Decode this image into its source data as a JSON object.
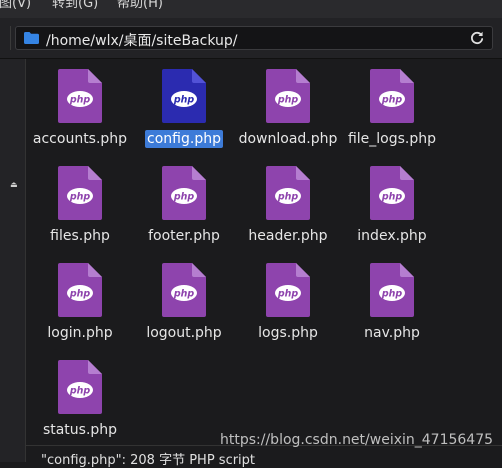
{
  "menubar": {
    "items": [
      {
        "label": "视图(V)"
      },
      {
        "label": "转到(G)"
      },
      {
        "label": "帮助(H)"
      }
    ]
  },
  "pathbar": {
    "path": "/home/wlx/桌面/siteBackup/"
  },
  "files": [
    {
      "name": "accounts.php",
      "selected": false
    },
    {
      "name": "config.php",
      "selected": true
    },
    {
      "name": "download.php",
      "selected": false
    },
    {
      "name": "file_logs.php",
      "selected": false
    },
    {
      "name": "files.php",
      "selected": false
    },
    {
      "name": "footer.php",
      "selected": false
    },
    {
      "name": "header.php",
      "selected": false
    },
    {
      "name": "index.php",
      "selected": false
    },
    {
      "name": "login.php",
      "selected": false
    },
    {
      "name": "logout.php",
      "selected": false
    },
    {
      "name": "logs.php",
      "selected": false
    },
    {
      "name": "nav.php",
      "selected": false
    },
    {
      "name": "status.php",
      "selected": false
    }
  ],
  "icon_text": "php",
  "colors": {
    "php_icon": "#8e44ad",
    "php_icon_fold": "#b57ed0",
    "php_icon_selected": "#2b2bb0",
    "selection": "#3d7bd8",
    "folder": "#3584e4"
  },
  "statusbar": {
    "text": "\"config.php\": 208 字节 PHP script"
  },
  "watermark": "https://blog.csdn.net/weixin_47156475"
}
